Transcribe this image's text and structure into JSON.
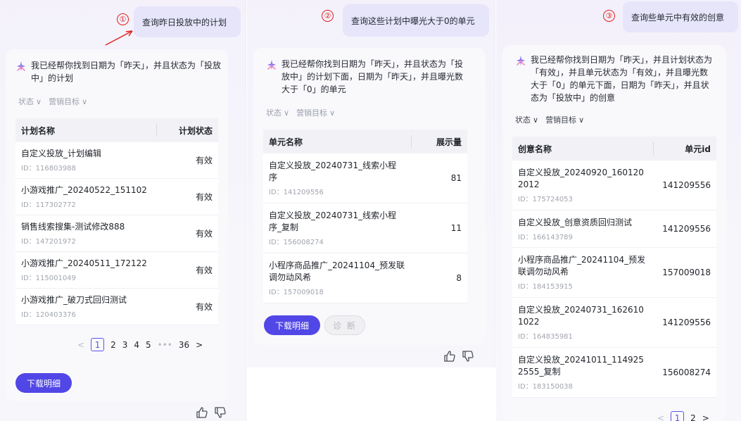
{
  "panel1": {
    "step_number": "①",
    "query": "查询昨日投放中的计划",
    "reply": "我已经帮你找到日期为「昨天」，并且状态为「投放中」的计划",
    "filters": [
      "状态",
      "营销目标"
    ],
    "table": {
      "headers": [
        "计划名称",
        "计划状态"
      ],
      "rows": [
        {
          "name": "自定义投放_计划编辑",
          "id": "ID：116803988",
          "value": "有效"
        },
        {
          "name": "小游戏推广_20240522_151102",
          "id": "ID：117302772",
          "value": "有效"
        },
        {
          "name": "销售线索搜集-测试修改888",
          "id": "ID：147201972",
          "value": "有效"
        },
        {
          "name": "小游戏推广_20240511_172122",
          "id": "ID：115001049",
          "value": "有效"
        },
        {
          "name": "小游戏推广_破刀式回归测试",
          "id": "ID：120403376",
          "value": "有效"
        }
      ]
    },
    "pager": {
      "prev": "<",
      "pages": [
        "1",
        "2",
        "3",
        "4",
        "5"
      ],
      "ellipsis": "•••",
      "last": "36",
      "next": ">"
    },
    "download_label": "下载明细"
  },
  "panel2": {
    "step_number": "②",
    "query": "查询这些计划中曝光大于0的单元",
    "reply": "我已经帮你找到日期为「昨天」，并且状态为「投放中」的计划下面，日期为「昨天」，并且曝光数大于「0」的单元",
    "filters": [
      "状态",
      "营销目标"
    ],
    "table": {
      "headers": [
        "单元名称",
        "展示量"
      ],
      "rows": [
        {
          "name": "自定义投放_20240731_线索小程序",
          "id": "ID：141209556",
          "value": "81"
        },
        {
          "name": "自定义投放_20240731_线索小程序_复制",
          "id": "ID：156008274",
          "value": "11"
        },
        {
          "name": "小程序商品推广_20241104_预发联调勿动风希",
          "id": "ID：157009018",
          "value": "8"
        }
      ]
    },
    "download_label": "下载明细",
    "diagnose_label": "诊 断"
  },
  "panel3": {
    "step_number": "③",
    "query": "查询些单元中有效的创意",
    "reply": "我已经帮你找到日期为「昨天」，并且计划状态为「有效」，并且单元状态为「有效」，并且曝光数大于「0」的单元下面，日期为「昨天」，并且状态为「投放中」的创意",
    "filters": [
      "状态",
      "营销目标"
    ],
    "table": {
      "headers": [
        "创意名称",
        "单元id"
      ],
      "rows": [
        {
          "name": "自定义投放_20240920_1601202012",
          "id": "ID：175724053",
          "value": "141209556"
        },
        {
          "name": "自定义投放_创意资质回归测试",
          "id": "ID：166143789",
          "value": "141209556"
        },
        {
          "name": "小程序商品推广_20241104_预发联调勿动风希",
          "id": "ID：184153915",
          "value": "157009018"
        },
        {
          "name": "自定义投放_20240731_1626101022",
          "id": "ID：164835981",
          "value": "141209556"
        },
        {
          "name": "自定义投放_20241011_1149252555_复制",
          "id": "ID：183150038",
          "value": "156008274"
        }
      ]
    },
    "pager": {
      "prev": "<",
      "pages": [
        "1",
        "2"
      ],
      "next": ">"
    }
  },
  "icons": {
    "ai": "ai-assistant-icon",
    "like": "thumbs-up-icon",
    "dislike": "thumbs-down-icon",
    "dropdown": "chevron-down-icon",
    "annotation": "red-arrow-annotation"
  },
  "colors": {
    "accent": "#5147e6",
    "bubble": "#e6e5fa",
    "annotation": "#e0211e"
  }
}
